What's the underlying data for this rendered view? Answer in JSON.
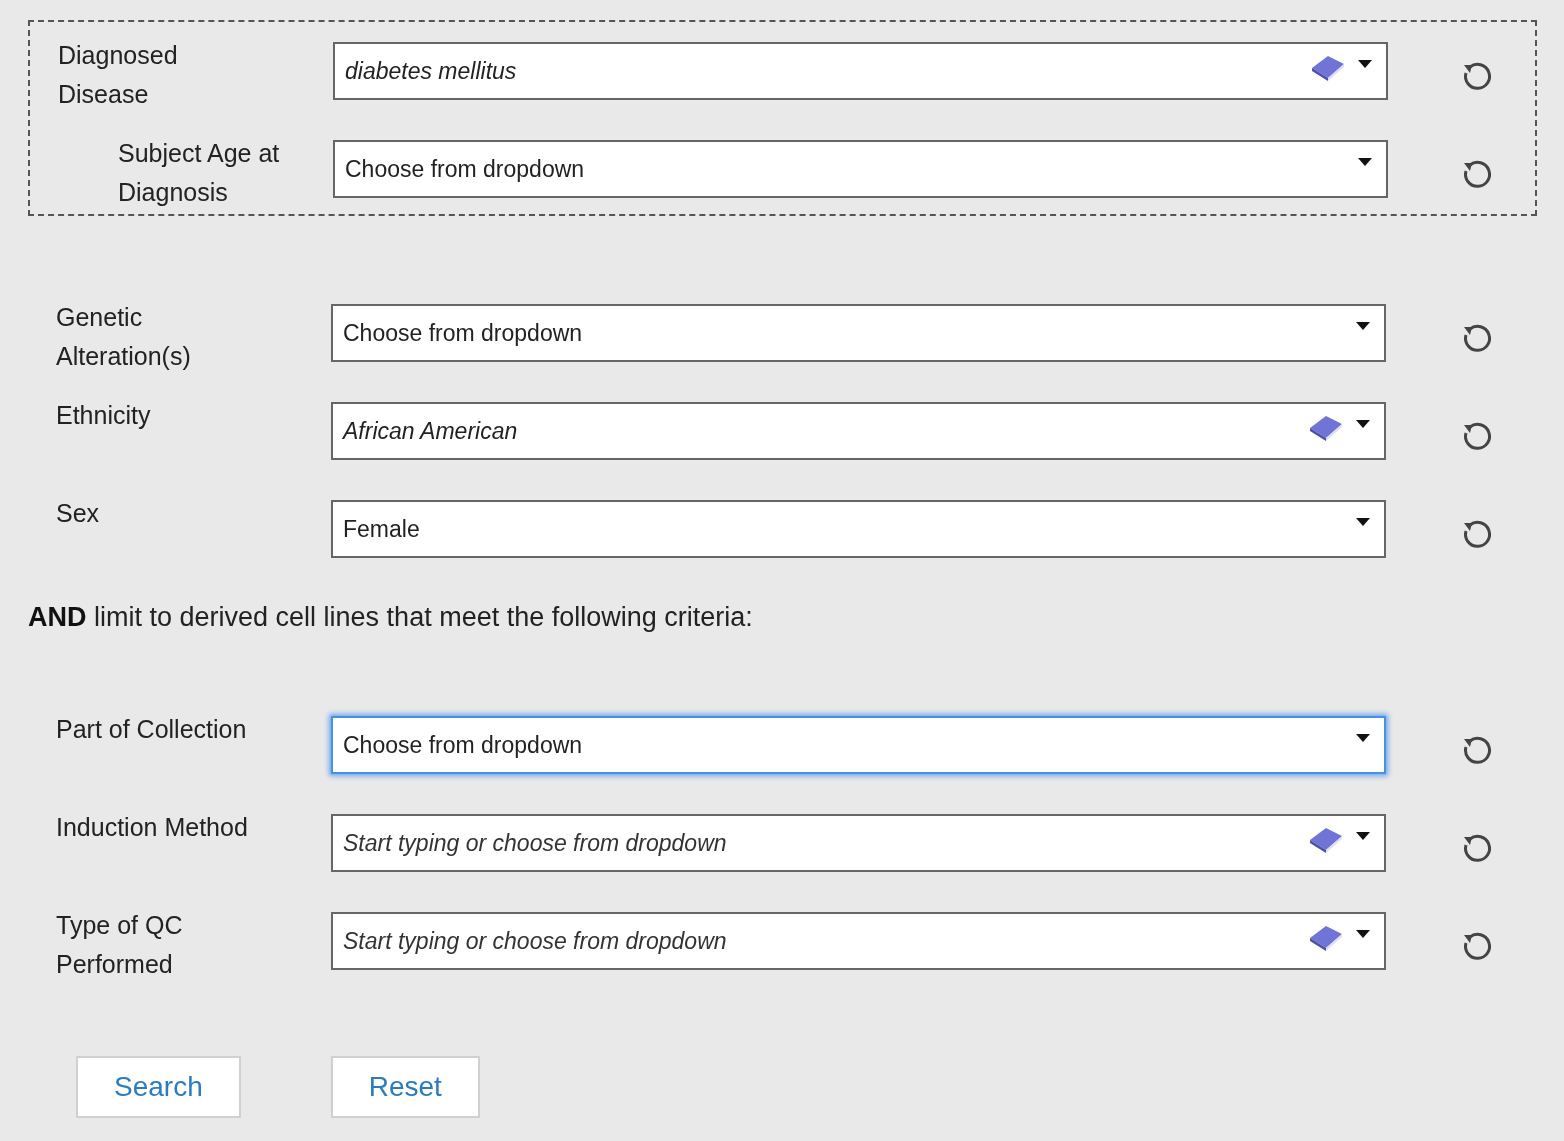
{
  "disease_group": [
    {
      "label": "Diagnosed Disease",
      "kind": "ontology",
      "value": "diabetes mellitus",
      "focused": false,
      "children": [
        {
          "label": "Subject Age at Diagnosis",
          "kind": "select",
          "value": "Choose from dropdown",
          "focused": false
        }
      ]
    }
  ],
  "subject_fields": [
    {
      "label": "Genetic Alteration(s)",
      "kind": "select",
      "value": "Choose from dropdown",
      "focused": false
    },
    {
      "label": "Ethnicity",
      "kind": "ontology",
      "value": "African American",
      "focused": false
    },
    {
      "label": "Sex",
      "kind": "select",
      "value": "Female",
      "focused": false
    }
  ],
  "criteria_note": "**AND** limit to derived cell lines that meet the following criteria:",
  "cell_line_fields": [
    {
      "label": "Part of Collection",
      "kind": "select",
      "value": "Choose from dropdown",
      "focused": true
    },
    {
      "label": "Induction Method",
      "kind": "ontology",
      "placeholder": "Start typing or choose from dropdown",
      "focused": false
    },
    {
      "label": "Type of QC Performed",
      "kind": "ontology",
      "placeholder": "Start typing or choose from dropdown",
      "focused": false
    }
  ],
  "buttons": [
    "Search",
    "Reset"
  ]
}
